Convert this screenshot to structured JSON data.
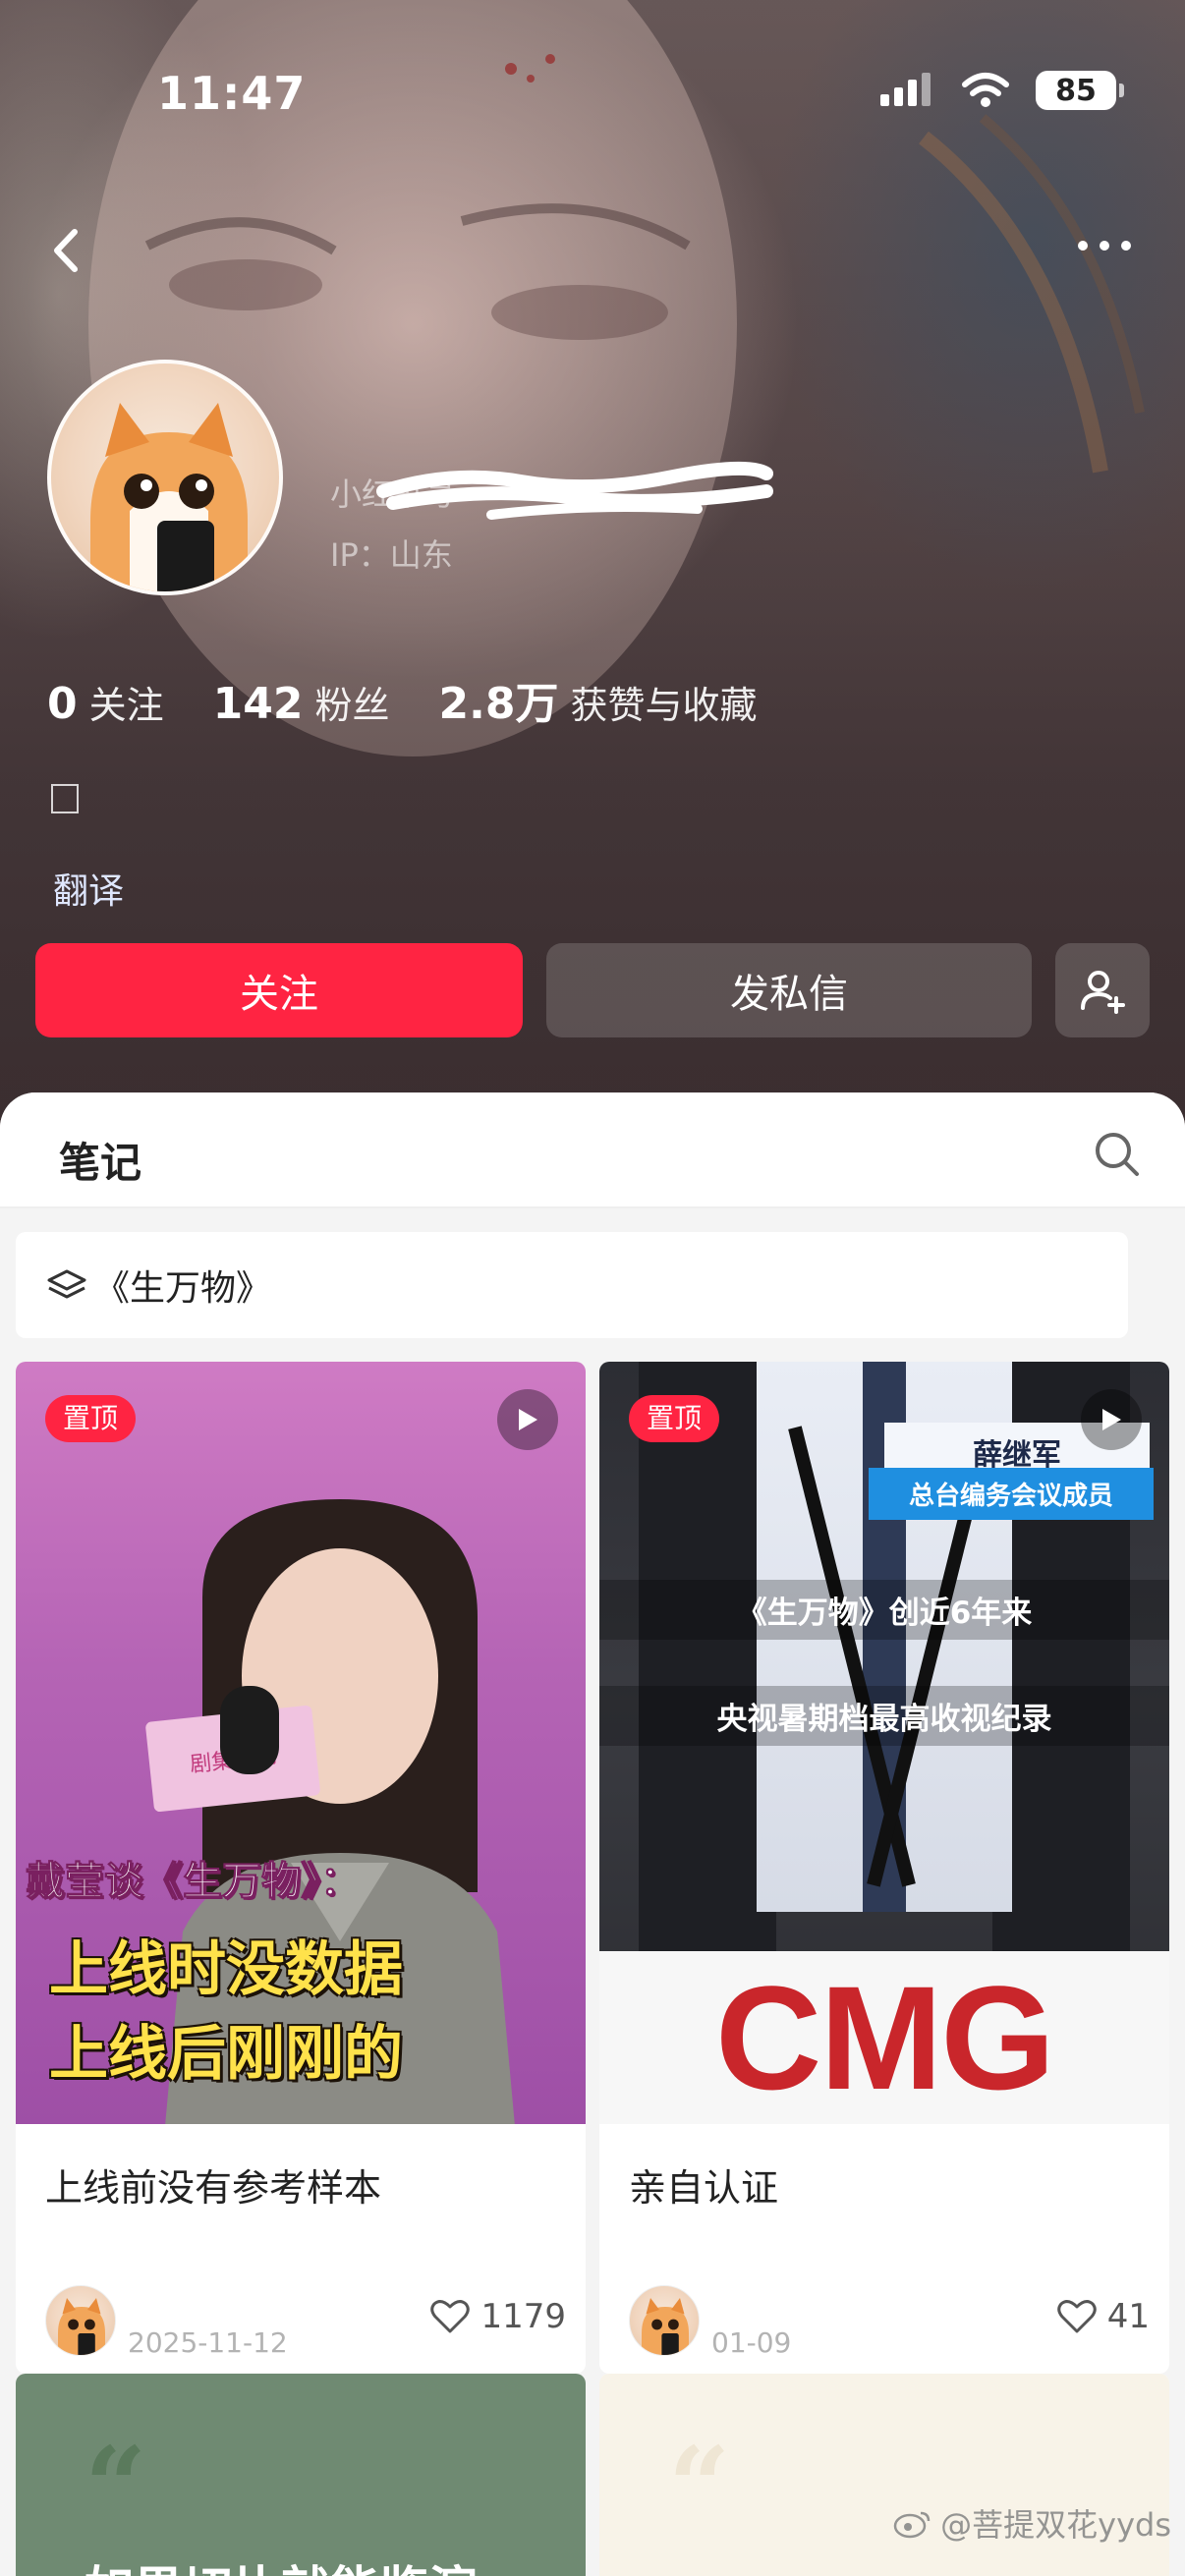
{
  "status_bar": {
    "time": "11:47",
    "battery": "85"
  },
  "profile": {
    "id_prefix": "小红书号",
    "ip": "IP：山东",
    "stats": [
      {
        "num": "0",
        "label": "关注"
      },
      {
        "num": "142",
        "label": "粉丝"
      },
      {
        "num": "2.8万",
        "label": "获赞与收藏"
      }
    ],
    "translate": "翻译",
    "follow_label": "关注",
    "message_label": "发私信"
  },
  "tabs": {
    "notes": "笔记"
  },
  "collection": {
    "label": "《生万物》"
  },
  "cards": [
    {
      "pinned": "置顶",
      "cover_sub": "戴莹谈《生万物》：",
      "cover_line1": "上线时没数据",
      "cover_line2": "上线后刚刚的",
      "sign": "剧集沙龙",
      "title": "上线前没有参考样本",
      "date": "2025-11-12",
      "likes": "1179"
    },
    {
      "pinned": "置顶",
      "name_tag": "薛继军",
      "name_role": "总台编务会议成员",
      "caption1": "《生万物》创近6年来",
      "caption2": "央视暑期档最高收视纪录",
      "logo": "CMG",
      "title": "亲自认证",
      "date": "01-09",
      "likes": "41"
    },
    {
      "quote": "“",
      "text": "如果切片就能鉴演"
    },
    {
      "quote": "“"
    }
  ],
  "watermark": "@菩提双花yyds",
  "colors": {
    "accent": "#ff2442",
    "translate": "#dfe7ff"
  }
}
